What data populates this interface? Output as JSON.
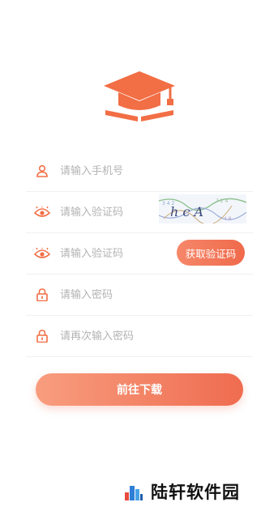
{
  "colors": {
    "accent": "#f26e45",
    "placeholder": "#b3b3b3",
    "button_gradient": [
      "#f89d7e",
      "#ef6c50"
    ]
  },
  "logo": {
    "icon": "graduation-cap-book-icon"
  },
  "form": {
    "phone": {
      "icon": "user-icon",
      "placeholder": "请输入手机号"
    },
    "captcha": {
      "icon": "eye-icon",
      "placeholder": "请输入验证码",
      "image_text": "h c A"
    },
    "sms_code": {
      "icon": "eye-icon",
      "placeholder": "请输入验证码",
      "button_label": "获取验证码"
    },
    "password": {
      "icon": "lock-icon",
      "placeholder": "请输入密码"
    },
    "confirm_password": {
      "icon": "lock-icon",
      "placeholder": "请再次输入密码"
    }
  },
  "submit_label": "前往下载",
  "watermark": {
    "text": "陆轩软件园",
    "icon": "building-logo-icon"
  }
}
